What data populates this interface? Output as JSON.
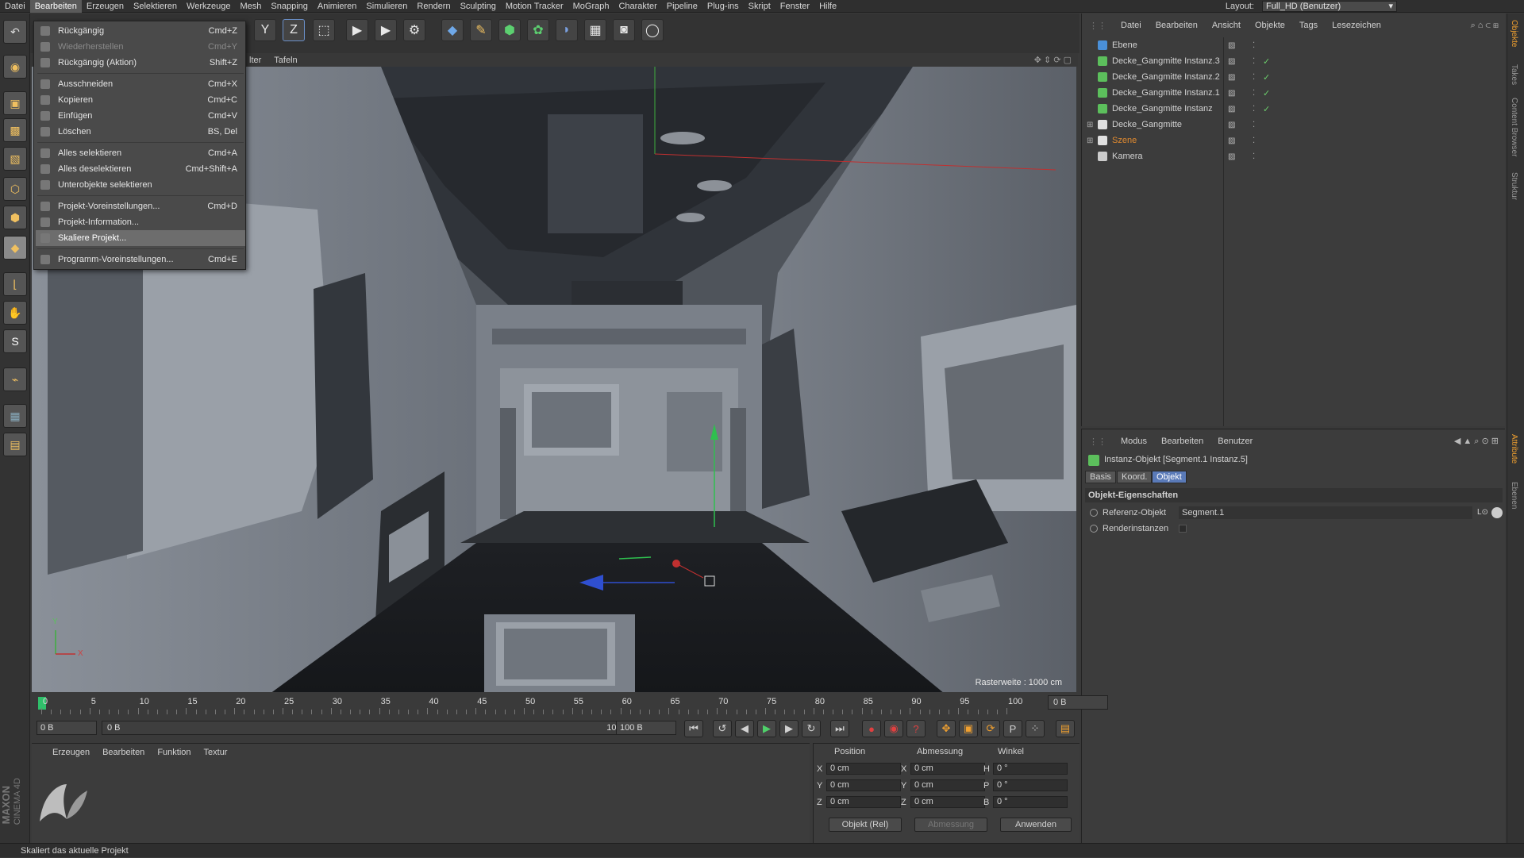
{
  "menubar": [
    "Datei",
    "Bearbeiten",
    "Erzeugen",
    "Selektieren",
    "Werkzeuge",
    "Mesh",
    "Snapping",
    "Animieren",
    "Simulieren",
    "Rendern",
    "Sculpting",
    "Motion Tracker",
    "MoGraph",
    "Charakter",
    "Pipeline",
    "Plug-ins",
    "Skript",
    "Fenster",
    "Hilfe"
  ],
  "active_menu": "Bearbeiten",
  "layout_label": "Layout:",
  "layout_value": "Full_HD (Benutzer)",
  "toolbar": {
    "y_label": "Y",
    "z_label": "Z"
  },
  "viewport": {
    "header_filter": "lter",
    "header_tafeln": "Tafeln",
    "rasterweite": "Rasterweite : 1000 cm",
    "axis_y": "Y",
    "axis_x": "X"
  },
  "dropdown": {
    "items": [
      {
        "label": "Rückgängig",
        "shortcut": "Cmd+Z",
        "state": "normal"
      },
      {
        "label": "Wiederherstellen",
        "shortcut": "Cmd+Y",
        "state": "disabled"
      },
      {
        "label": "Rückgängig (Aktion)",
        "shortcut": "Shift+Z",
        "state": "normal"
      },
      {
        "label": "Ausschneiden",
        "shortcut": "Cmd+X",
        "state": "normal"
      },
      {
        "label": "Kopieren",
        "shortcut": "Cmd+C",
        "state": "normal"
      },
      {
        "label": "Einfügen",
        "shortcut": "Cmd+V",
        "state": "normal"
      },
      {
        "label": "Löschen",
        "shortcut": "BS, Del",
        "state": "normal"
      },
      {
        "label": "Alles selektieren",
        "shortcut": "Cmd+A",
        "state": "normal"
      },
      {
        "label": "Alles deselektieren",
        "shortcut": "Cmd+Shift+A",
        "state": "normal"
      },
      {
        "label": "Unterobjekte selektieren",
        "shortcut": "",
        "state": "normal"
      },
      {
        "label": "Projekt-Voreinstellungen...",
        "shortcut": "Cmd+D",
        "state": "normal"
      },
      {
        "label": "Projekt-Information...",
        "shortcut": "",
        "state": "normal"
      },
      {
        "label": "Skaliere Projekt...",
        "shortcut": "",
        "state": "highlighted"
      },
      {
        "label": "Programm-Voreinstellungen...",
        "shortcut": "Cmd+E",
        "state": "normal"
      }
    ]
  },
  "object_manager": {
    "menu": [
      "Datei",
      "Bearbeiten",
      "Ansicht",
      "Objekte",
      "Tags",
      "Lesezeichen"
    ],
    "objects": [
      {
        "name": "Ebene",
        "checked": false,
        "color": "#4a90d9"
      },
      {
        "name": "Decke_Gangmitte Instanz.3",
        "checked": true,
        "color": "#5cbf5c"
      },
      {
        "name": "Decke_Gangmitte Instanz.2",
        "checked": true,
        "color": "#5cbf5c"
      },
      {
        "name": "Decke_Gangmitte Instanz.1",
        "checked": true,
        "color": "#5cbf5c"
      },
      {
        "name": "Decke_Gangmitte Instanz",
        "checked": true,
        "color": "#5cbf5c"
      },
      {
        "name": "Decke_Gangmitte",
        "checked": false,
        "color": "#e0e0e0"
      },
      {
        "name": "Szene",
        "checked": false,
        "color": "#e0e0e0",
        "highlight": "#e08a30"
      },
      {
        "name": "Kamera",
        "checked": false,
        "color": "#cccccc"
      }
    ]
  },
  "attribute_manager": {
    "menu": [
      "Modus",
      "Bearbeiten",
      "Benutzer"
    ],
    "title": "Instanz-Objekt [Segment.1 Instanz.5]",
    "tabs": [
      "Basis",
      "Koord.",
      "Objekt"
    ],
    "active_tab": "Objekt",
    "section": "Objekt-Eigenschaften",
    "ref_label": "Referenz-Objekt",
    "ref_value": "Segment.1",
    "render_label": "Renderinstanzen"
  },
  "right_tabs": [
    "Objekte",
    "Takes",
    "Content Browser",
    "Struktur"
  ],
  "right_tabs_lower": [
    "Attribute",
    "Ebenen"
  ],
  "timeline": {
    "ticks": [
      "0",
      "5",
      "10",
      "15",
      "20",
      "25",
      "30",
      "35",
      "40",
      "45",
      "50",
      "55",
      "60",
      "65",
      "70",
      "75",
      "80",
      "85",
      "90",
      "95",
      "100"
    ],
    "end_field": "0 B",
    "start_field": "0 B",
    "range_start": "0 B",
    "range_end": "100 B",
    "max_field": "100 B"
  },
  "material_manager": {
    "menu": [
      "Erzeugen",
      "Bearbeiten",
      "Funktion",
      "Textur"
    ]
  },
  "coords": {
    "headers": [
      "Position",
      "Abmessung",
      "Winkel"
    ],
    "rows": [
      {
        "a1": "X",
        "v1": "0 cm",
        "a2": "X",
        "v2": "0 cm",
        "a3": "H",
        "v3": "0 °"
      },
      {
        "a1": "Y",
        "v1": "0 cm",
        "a2": "Y",
        "v2": "0 cm",
        "a3": "P",
        "v3": "0 °"
      },
      {
        "a1": "Z",
        "v1": "0 cm",
        "a2": "Z",
        "v2": "0 cm",
        "a3": "B",
        "v3": "0 °"
      }
    ],
    "mode": "Objekt (Rel)",
    "size_mode": "Abmessung",
    "apply": "Anwenden"
  },
  "status": "Skaliert das aktuelle Projekt",
  "brand": {
    "maxon": "MAXON",
    "product": "CINEMA 4D"
  }
}
